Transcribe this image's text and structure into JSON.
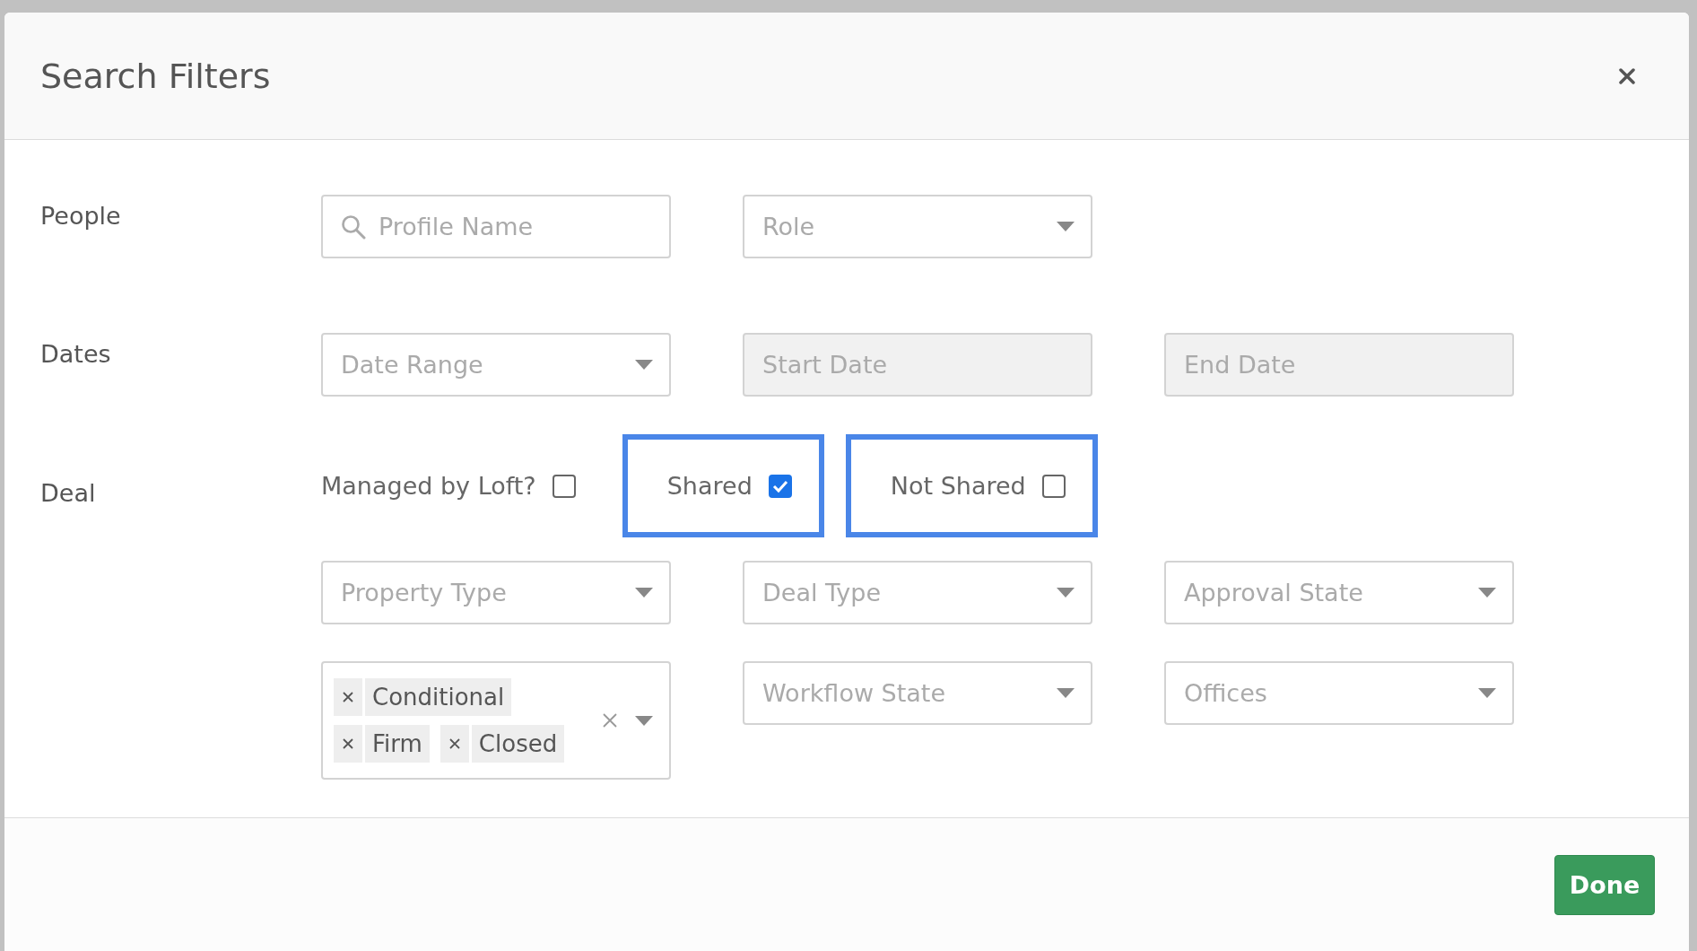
{
  "dialog": {
    "title": "Search Filters"
  },
  "sections": [
    {
      "label": "People",
      "fields": [
        {
          "kind": "search",
          "placeholder": "Profile Name"
        },
        {
          "kind": "select",
          "placeholder": "Role"
        }
      ]
    },
    {
      "label": "Dates",
      "fields": [
        {
          "kind": "select",
          "placeholder": "Date Range"
        },
        {
          "kind": "text",
          "placeholder": "Start Date",
          "disabled": true
        },
        {
          "kind": "text",
          "placeholder": "End Date",
          "disabled": true
        }
      ]
    },
    {
      "label": "Deal",
      "checkboxes": [
        {
          "label": "Managed by Loft?",
          "checked": false,
          "highlighted": false
        },
        {
          "label": "Shared",
          "checked": true,
          "highlighted": true
        },
        {
          "label": "Not Shared",
          "checked": false,
          "highlighted": true
        }
      ],
      "fields": [
        {
          "kind": "select",
          "placeholder": "Property Type"
        },
        {
          "kind": "select",
          "placeholder": "Deal Type"
        },
        {
          "kind": "select",
          "placeholder": "Approval State"
        },
        {
          "kind": "multiselect",
          "tags": [
            "Conditional",
            "Firm",
            "Closed"
          ]
        },
        {
          "kind": "select",
          "placeholder": "Workflow State"
        },
        {
          "kind": "select",
          "placeholder": "Offices"
        }
      ]
    }
  ],
  "footer": {
    "button": "Done"
  }
}
